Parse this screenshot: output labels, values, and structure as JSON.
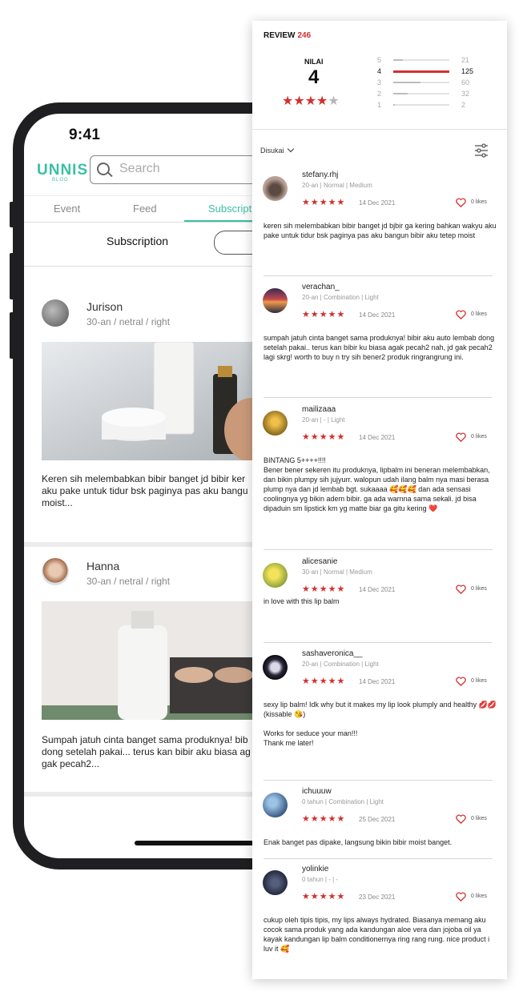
{
  "phone": {
    "time": "9:41",
    "logo": "UNNIS",
    "logo_sub": "BLOG",
    "search_placeholder": "Search",
    "tabs": [
      "Event",
      "Feed",
      "Subscription"
    ],
    "subbar_title": "Subscription",
    "posts": [
      {
        "name": "Jurison",
        "meta": "30-an / netral / right",
        "text": [
          "Keren sih melembabkan bibir banget jd bibir ker",
          "aku pake untuk tidur bsk paginya pas aku bangu",
          "moist..."
        ]
      },
      {
        "name": "Hanna",
        "meta": "30-an / netral / right",
        "text": [
          "Sumpah jatuh cinta banget sama produknya! bib",
          "dong setelah pakai... terus kan bibir aku biasa ag",
          "gak pecah2..."
        ]
      }
    ]
  },
  "review_panel": {
    "title": "REVIEW",
    "count": "246",
    "nilai_label": "NILAI",
    "nilai_value": "4",
    "rating_stars": 4,
    "distribution": [
      {
        "star": "5",
        "count": "21",
        "fraction": 0.17
      },
      {
        "star": "4",
        "count": "125",
        "fraction": 1.0
      },
      {
        "star": "3",
        "count": "60",
        "fraction": 0.48
      },
      {
        "star": "2",
        "count": "32",
        "fraction": 0.26
      },
      {
        "star": "1",
        "count": "2",
        "fraction": 0.03
      }
    ],
    "sort_label": "Disukai",
    "accent_color": "#d32f2f",
    "reviews": [
      {
        "user": "stefany.rhj",
        "meta": "20-an | Normal | Medium",
        "stars": "★★★★★",
        "date": "14 Dec 2021",
        "likes": "0 likes",
        "text": "keren sih melembabkan bibir banget jd bjbir ga kering bahkan wakyu aku pake untuk tidur bsk paginya pas aku bangun bibir aku tetep moist"
      },
      {
        "user": "verachan_",
        "meta": "20-an | Combination | Light",
        "stars": "★★★★★",
        "date": "14 Dec 2021",
        "likes": "0 likes",
        "text": "sumpah jatuh cinta banget sama produknya! bibir aku auto lembab dong setelah pakai.. terus kan bibir ku biasa agak pecah2 nah, jd gak pecah2 lagi skrg! worth to buy n try sih bener2 produk ringrangrung ini."
      },
      {
        "user": "mailizaaa",
        "meta": "20-an | - | Light",
        "stars": "★★★★★",
        "date": "14 Dec 2021",
        "likes": "0 likes",
        "text": "BINTANG 5++++!!!!\nBener bener sekeren itu produknya, lipbalm ini beneran melembabkan, dan bikin plumpy sih jujyurr. walopun udah ilang balm nya masi berasa plump nya dan jd lembab bgt. sukaaaa 🥰🥰🥰 dan ada sensasi coolingnya yg bikin adem bibir.  ga ada warnna sama sekali. jd bisa dipaduin sm lipstick km yg matte biar ga gitu kering ❤️"
      },
      {
        "user": "alicesanie",
        "meta": "30-an | Normal | Medium",
        "stars": "★★★★★",
        "date": "14 Dec 2021",
        "likes": "0 likes",
        "text": "in love with this lip balm"
      },
      {
        "user": "sashaveronica__",
        "meta": "20-an | Combination | Light",
        "stars": "★★★★★",
        "date": "14 Dec 2021",
        "likes": "0 likes",
        "text": "sexy lip balm! Idk why but it makes my lip look plumply and healthy 💋💋 (kissable 😘)\n\nWorks for seduce your man!!!\nThank me later!"
      },
      {
        "user": "ichuuuw",
        "meta": "0 tahun | Combination | Light",
        "stars": "★★★★★",
        "date": "25 Dec 2021",
        "likes": "0 likes",
        "text": "Enak banget pas dipake, langsung bikin bibir moist banget."
      },
      {
        "user": "yolinkie",
        "meta": "0 tahun | - | -",
        "stars": "★★★★★",
        "date": "23 Dec 2021",
        "likes": "0 likes",
        "text": "cukup oleh tipis tipis, my lips always hydrated. Biasanya memang aku cocok sama produk yang ada kandungan aloe vera dan jojoba oil ya kayak kandungan lip balm conditionernya ring rang rung. nice product i luv it 🥰"
      }
    ]
  }
}
